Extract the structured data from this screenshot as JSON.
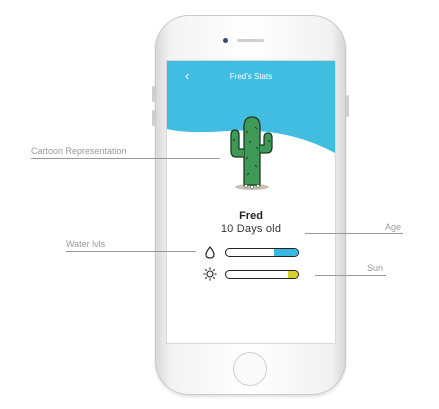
{
  "app": {
    "title": "Fred's Stats",
    "back_icon": "chevron-left-icon"
  },
  "plant": {
    "name": "Fred",
    "age": "10 Days old"
  },
  "stats": {
    "water": {
      "icon": "droplet-icon",
      "level": 0.33,
      "color": "#3bb8e0"
    },
    "sun": {
      "icon": "sun-icon",
      "level": 0.14,
      "color": "#d6d02a"
    }
  },
  "colors": {
    "header": "#41bde2",
    "cactus": "#3f9a57"
  },
  "annotations": {
    "cartoon": "Cartoon Representation",
    "water": "Water lvls",
    "age": "Age",
    "sun": "Sun"
  }
}
